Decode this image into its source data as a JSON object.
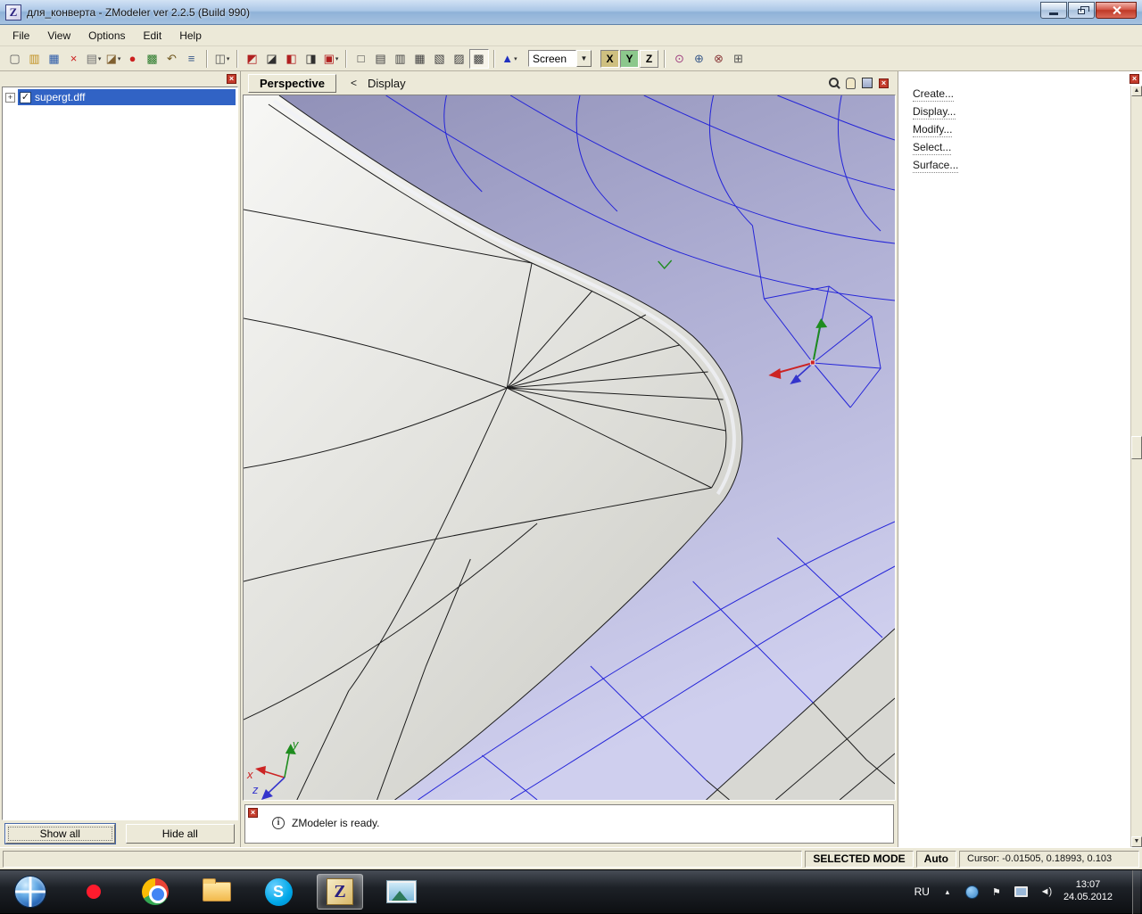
{
  "window": {
    "app_icon_letter": "Z",
    "title": "для_конверта - ZModeler ver 2.2.5 (Build 990)"
  },
  "menu": {
    "items": [
      {
        "name": "menu-file",
        "label": "File"
      },
      {
        "name": "menu-view",
        "label": "View"
      },
      {
        "name": "menu-options",
        "label": "Options"
      },
      {
        "name": "menu-edit",
        "label": "Edit"
      },
      {
        "name": "menu-help",
        "label": "Help"
      }
    ]
  },
  "toolbar": {
    "file_icons": [
      {
        "name": "new-file-icon",
        "glyph": "▢",
        "color": "#5a5a5a"
      },
      {
        "name": "open-folder-icon",
        "glyph": "▥",
        "color": "#c09020"
      },
      {
        "name": "save-icon",
        "glyph": "▦",
        "color": "#2858a8"
      },
      {
        "name": "delete-icon",
        "glyph": "×",
        "color": "#cc2020"
      },
      {
        "name": "paste-icon",
        "glyph": "▤",
        "color": "#707070",
        "caret": "▾"
      },
      {
        "name": "import-export-icon",
        "glyph": "◪",
        "color": "#806030",
        "caret": "▾"
      },
      {
        "name": "record-icon",
        "glyph": "●",
        "color": "#cc2020"
      },
      {
        "name": "filter-grid-icon",
        "glyph": "▩",
        "color": "#2a7a2a"
      },
      {
        "name": "undo-icon",
        "glyph": "↶",
        "color": "#705820"
      },
      {
        "name": "notes-icon",
        "glyph": "≡",
        "color": "#3a5a8a"
      }
    ],
    "workspace_icons": [
      {
        "name": "layout-icon",
        "glyph": "◫",
        "color": "#555555",
        "caret": "▾"
      }
    ],
    "selection_icons": [
      {
        "name": "select-mode-icon-1",
        "glyph": "◩",
        "color": "#b02020"
      },
      {
        "name": "select-mode-icon-2",
        "glyph": "◪",
        "color": "#303030"
      },
      {
        "name": "select-mode-icon-3",
        "glyph": "◧",
        "color": "#b02020"
      },
      {
        "name": "select-mode-icon-4",
        "glyph": "◨",
        "color": "#303030"
      },
      {
        "name": "select-mode-icon-5",
        "glyph": "▣",
        "color": "#b02020",
        "caret": "▾"
      }
    ],
    "display_icons": [
      {
        "name": "view-toggle-icon-1",
        "glyph": "□",
        "color": "#404040"
      },
      {
        "name": "view-toggle-icon-2",
        "glyph": "▤",
        "color": "#404040"
      },
      {
        "name": "view-toggle-icon-3",
        "glyph": "▥",
        "color": "#404040"
      },
      {
        "name": "view-toggle-icon-4",
        "glyph": "▦",
        "color": "#404040"
      },
      {
        "name": "view-toggle-icon-5",
        "glyph": "▧",
        "color": "#404040"
      },
      {
        "name": "view-toggle-icon-6",
        "glyph": "▨",
        "color": "#404040"
      },
      {
        "name": "view-toggle-icon-7",
        "glyph": "▩",
        "color": "#404040",
        "state": "pressed"
      }
    ],
    "vertex_icons": [
      {
        "name": "vertices-mode-icon",
        "glyph": "▲",
        "color": "#2030c0",
        "caret": "▾"
      }
    ],
    "screen_dropdown": {
      "name": "screen-mode-select",
      "value": "Screen",
      "caret": "▼"
    },
    "axis_toggles": [
      {
        "name": "axis-x-toggle",
        "label": "X",
        "state": "on-x"
      },
      {
        "name": "axis-y-toggle",
        "label": "Y",
        "state": "on-y"
      },
      {
        "name": "axis-z-toggle",
        "label": "Z",
        "state": "off"
      }
    ],
    "gizmo_icons": [
      {
        "name": "material-icon",
        "glyph": "⊙",
        "color": "#a04080"
      },
      {
        "name": "uv-mapper-icon",
        "glyph": "⊕",
        "color": "#3a5a8a"
      },
      {
        "name": "axes-tool-icon",
        "glyph": "⊗",
        "color": "#8a3a3a"
      },
      {
        "name": "snap-icon",
        "glyph": "⊞",
        "color": "#555555"
      }
    ]
  },
  "left_panel": {
    "expander": "+",
    "item_label": "supergt.dff",
    "item_checked": "✓",
    "show_all_label": "Show all",
    "hide_all_label": "Hide all"
  },
  "viewport": {
    "mode_button": "Perspective",
    "back_arrow": "<",
    "view_menu": "Display",
    "axis_labels": {
      "x": "x",
      "y": "y",
      "z": "z"
    }
  },
  "right_panel": {
    "commands": [
      {
        "name": "command-create",
        "label": "Create..."
      },
      {
        "name": "command-display",
        "label": "Display..."
      },
      {
        "name": "command-modify",
        "label": "Modify..."
      },
      {
        "name": "command-select",
        "label": "Select..."
      },
      {
        "name": "command-surface",
        "label": "Surface..."
      }
    ]
  },
  "log": {
    "info_glyph": "i",
    "message": "ZModeler is ready."
  },
  "status_bar": {
    "selected_mode": "SELECTED MODE",
    "auto": "Auto",
    "cursor": "Cursor: -0.01505, 0.18993, 0.103"
  },
  "taskbar": {
    "apps": [
      {
        "name": "start-button"
      },
      {
        "name": "opera-icon"
      },
      {
        "name": "chrome-icon"
      },
      {
        "name": "explorer-icon"
      },
      {
        "name": "skype-icon",
        "letter": "S"
      },
      {
        "name": "zmodeler-taskbar-icon",
        "letter": "Z",
        "state": "active"
      },
      {
        "name": "photo-viewer-icon"
      }
    ],
    "language": "RU",
    "tray_icons": [
      {
        "name": "hidden-icons-chevron",
        "glyph": "▴"
      },
      {
        "name": "network-globe-icon"
      },
      {
        "name": "action-center-flag-icon",
        "glyph": "⚑"
      },
      {
        "name": "display-settings-icon"
      },
      {
        "name": "volume-icon",
        "glyph": "◄)"
      }
    ],
    "clock_time": "13:07",
    "clock_date": "24.05.2012"
  }
}
